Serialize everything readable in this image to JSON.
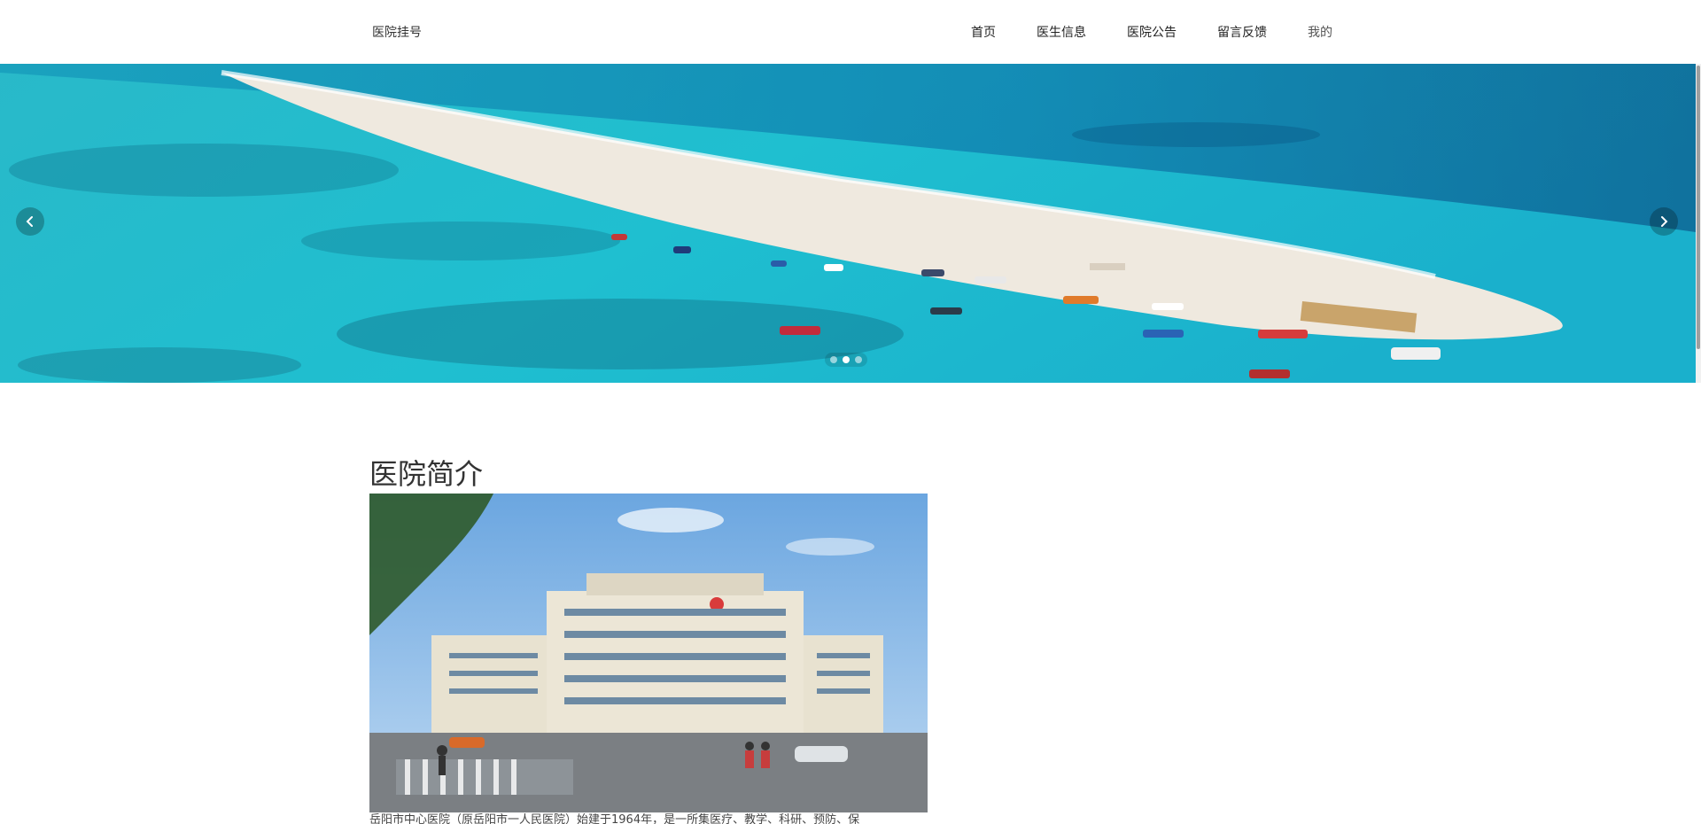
{
  "header": {
    "brand": "医院挂号",
    "nav": [
      {
        "label": "首页"
      },
      {
        "label": "医生信息"
      },
      {
        "label": "医院公告"
      },
      {
        "label": "留言反馈"
      },
      {
        "label": "我的"
      }
    ]
  },
  "carousel": {
    "slide_count": 3,
    "active_index": 1,
    "prev_icon": "chevron-left-icon",
    "next_icon": "chevron-right-icon"
  },
  "intro": {
    "title": "医院简介",
    "text": "岳阳市中心医院（原岳阳市一人民医院）始建于1964年，是一所集医疗、教学、科研、预防、保"
  },
  "colors": {
    "sea_light": "#2fc4d2",
    "sea_deep": "#0a4f8a",
    "sand": "#efe9df",
    "text": "#333333"
  }
}
